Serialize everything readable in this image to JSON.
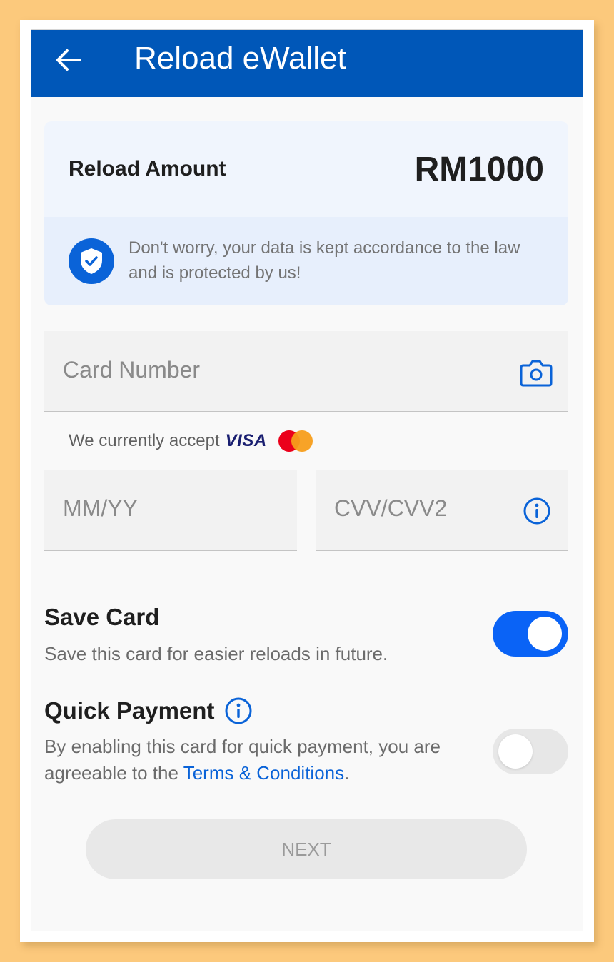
{
  "header": {
    "title": "Reload eWallet",
    "back_icon": "arrow-left-icon",
    "color": "#0057b8"
  },
  "reload": {
    "label": "Reload Amount",
    "amount": "RM1000",
    "notice": "Don't worry, your data is kept accordance to the law and is protected by us!",
    "notice_icon": "shield-check-icon"
  },
  "card_form": {
    "card_number_placeholder": "Card Number",
    "camera_icon": "camera-icon",
    "accept_text": "We currently accept",
    "accepted_brands": [
      "VISA",
      "Mastercard"
    ],
    "expiry_placeholder": "MM/YY",
    "cvv_placeholder": "CVV/CVV2",
    "cvv_info_icon": "info-icon"
  },
  "save_card": {
    "title": "Save Card",
    "description": "Save this card for easier reloads in future.",
    "enabled": true
  },
  "quick_payment": {
    "title": "Quick Payment",
    "description_prefix": "By enabling this card for quick payment, you are agreeable to the",
    "terms_link": "Terms & Conditions",
    "description_suffix": ".",
    "enabled": false
  },
  "actions": {
    "next_label": "NEXT"
  },
  "colors": {
    "accent": "#0a63f6",
    "link": "#0a63d8",
    "background": "#fcc97c"
  }
}
